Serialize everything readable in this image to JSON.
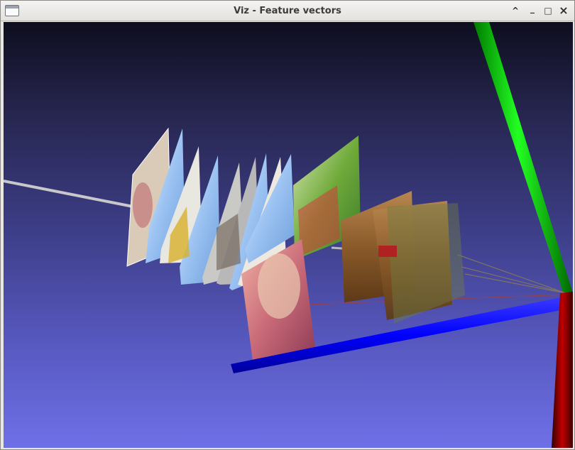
{
  "window": {
    "title": "Viz - Feature vectors",
    "controls": [
      "^",
      "_",
      "□",
      "×"
    ]
  },
  "scene": {
    "background_top": "#0e0e1f",
    "background_bottom": "#6e70e6",
    "axes": {
      "x_color": "#0000ff",
      "y_color": "#00dd00",
      "z_color": "#cc0000"
    }
  }
}
